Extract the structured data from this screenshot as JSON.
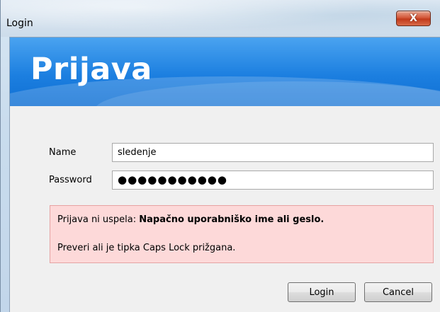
{
  "window": {
    "title": "Login",
    "close_label": "X"
  },
  "banner": {
    "heading": "Prijava"
  },
  "form": {
    "name_label": "Name",
    "name_value": "sledenje",
    "password_label": "Password",
    "password_value": "●●●●●●●●●●●"
  },
  "error": {
    "prefix": "Prijava ni uspela: ",
    "message_bold": "Napačno uporabniško ime ali geslo.",
    "hint": "Preveri ali je tipka Caps Lock prižgana."
  },
  "buttons": {
    "login": "Login",
    "cancel": "Cancel"
  }
}
